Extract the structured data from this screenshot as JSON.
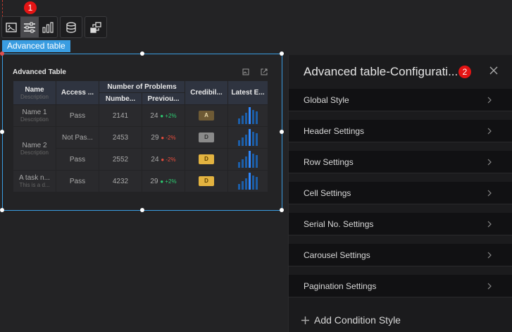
{
  "markers": {
    "toolbar": "1",
    "panel": "2"
  },
  "toolbar": {
    "buttons": [
      "image-card-icon",
      "sliders-icon",
      "bar-chart-icon",
      "database-icon",
      "flow-icon"
    ]
  },
  "component_label": "Advanced table",
  "table": {
    "title": "Advanced Table",
    "headers": {
      "name": "Name",
      "name_sub": "Description",
      "access": "Access ...",
      "problems": "Number of Problems",
      "number": "Numbe...",
      "previous": "Previou...",
      "credibility": "Credibil...",
      "latest": "Latest E..."
    },
    "rows": [
      {
        "name": "Name 1",
        "desc": "Description",
        "access": "Pass",
        "number": "2141",
        "prev": "24",
        "trend": "+2%",
        "dir": "up",
        "badge": "A"
      },
      {
        "name": "Name 2",
        "desc": "Description",
        "access": "Not Pas...",
        "number": "2453",
        "prev": "29",
        "trend": "-2%",
        "dir": "down",
        "badge": "D"
      },
      {
        "access": "Pass",
        "number": "2552",
        "prev": "24",
        "trend": "-2%",
        "dir": "down",
        "badge": "D"
      },
      {
        "name": "A task n...",
        "desc": "This is a d...",
        "access": "Pass",
        "number": "4232",
        "prev": "29",
        "trend": "+2%",
        "dir": "up",
        "badge": "D"
      }
    ]
  },
  "panel": {
    "title": "Advanced table-Configurati...",
    "items": [
      "Global Style",
      "Header Settings",
      "Row Settings",
      "Cell Settings",
      "Serial No. Settings",
      "Carousel Settings",
      "Pagination Settings"
    ],
    "add_label": "Add Condition Style"
  },
  "colors": {
    "accent": "#3a9de1",
    "marker": "#e41414",
    "up": "#2ecc71",
    "down": "#e74c3c"
  }
}
